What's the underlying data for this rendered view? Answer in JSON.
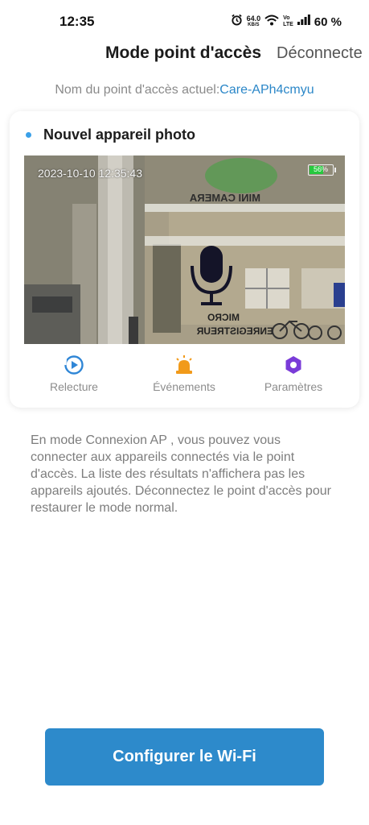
{
  "status_bar": {
    "time": "12:35",
    "net_speed_value": "64.0",
    "net_speed_unit": "KB/S",
    "volte_top": "Vo",
    "volte_bottom": "LTE",
    "battery": "60 %"
  },
  "header": {
    "title": "Mode point d'accès",
    "action": "Déconnecte"
  },
  "access_point": {
    "label": "Nom du point d'accès actuel:",
    "name": "Care-APh4cmyu"
  },
  "device": {
    "name": "Nouvel appareil photo",
    "status_color": "#3aa0e8",
    "preview": {
      "timestamp": "2023-10-10 12:35:43",
      "battery_text": "56%",
      "battery_level": 0.56,
      "sign_text_top": "MINI CAMERA",
      "sign_text_mic": "MICRO",
      "sign_text_rec": "ENREGISTREUR"
    },
    "actions": [
      {
        "label": "Relecture",
        "icon": "playback-icon",
        "color": "#2f86d6"
      },
      {
        "label": "Événements",
        "icon": "alarm-light-icon",
        "color": "#f19a1a"
      },
      {
        "label": "Paramètres",
        "icon": "hexagon-settings-icon",
        "color": "#7a3bd8"
      }
    ]
  },
  "info_text": "En mode  Connexion AP , vous pouvez vous connecter aux appareils connectés via le point d'accès. La liste des résultats n'affichera pas les appareils ajoutés. Déconnectez le point d'accès pour restaurer le mode normal.",
  "primary_button": {
    "label": "Configurer le Wi-Fi",
    "color": "#2d8acb"
  }
}
